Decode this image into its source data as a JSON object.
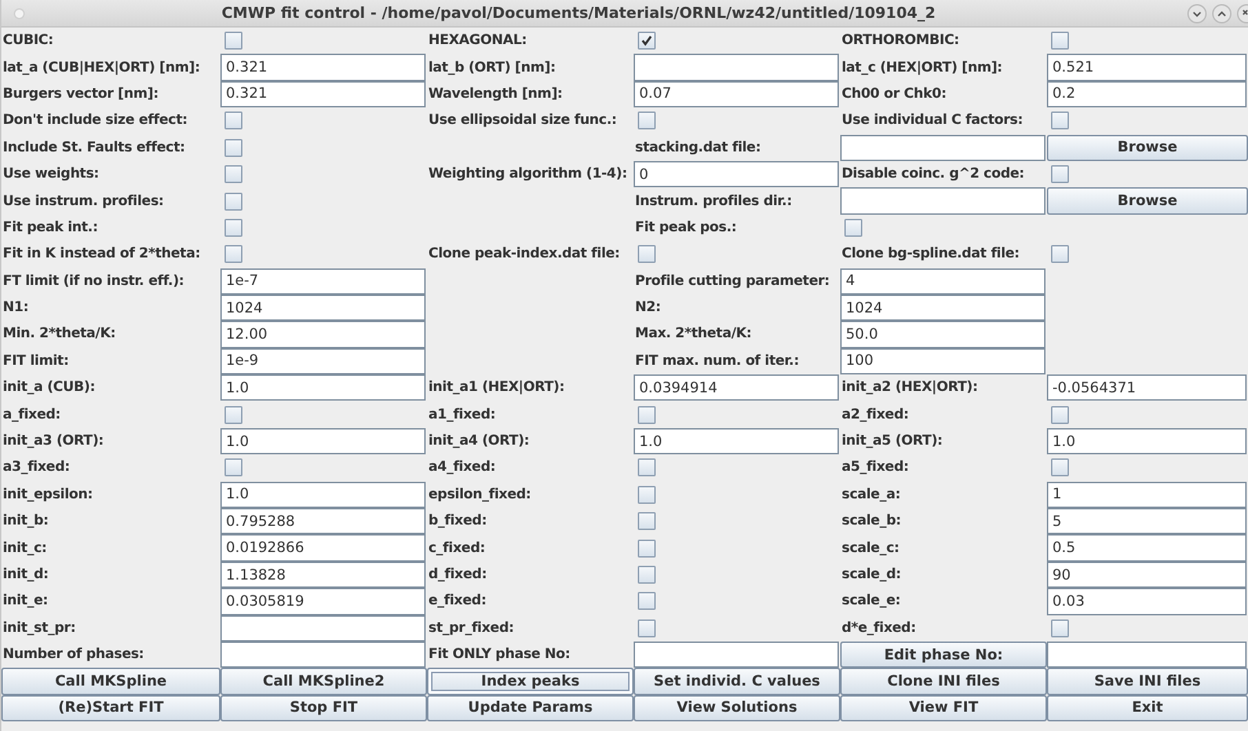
{
  "window": {
    "title": "CMWP fit control - /home/pavol/Documents/Materials/ORNL/wz42/untitled/109104_2"
  },
  "rows": [
    {
      "cells": [
        {
          "kind": "label",
          "text": "CUBIC:"
        },
        {
          "kind": "checkbox",
          "checked": false
        },
        {
          "kind": "label",
          "text": "HEXAGONAL:"
        },
        {
          "kind": "checkbox",
          "checked": true
        },
        {
          "kind": "label",
          "text": "ORTHOROMBIC:"
        },
        {
          "kind": "checkbox",
          "checked": false
        }
      ]
    },
    {
      "cells": [
        {
          "kind": "label",
          "text": "lat_a (CUB|HEX|ORT) [nm]:"
        },
        {
          "kind": "field",
          "value": "0.321"
        },
        {
          "kind": "label",
          "text": "lat_b (ORT) [nm]:"
        },
        {
          "kind": "field"
        },
        {
          "kind": "label",
          "text": "lat_c (HEX|ORT) [nm]:"
        },
        {
          "kind": "field",
          "value": "0.521"
        }
      ]
    },
    {
      "cells": [
        {
          "kind": "label",
          "text": "Burgers vector [nm]:"
        },
        {
          "kind": "field",
          "value": "0.321"
        },
        {
          "kind": "label",
          "text": "Wavelength [nm]:"
        },
        {
          "kind": "field",
          "value": "0.07"
        },
        {
          "kind": "label",
          "text": "Ch00 or Chk0:"
        },
        {
          "kind": "field",
          "value": "0.2"
        }
      ]
    },
    {
      "cells": [
        {
          "kind": "label",
          "text": "Don't include size effect:"
        },
        {
          "kind": "checkbox",
          "checked": false
        },
        {
          "kind": "label",
          "text": "Use ellipsoidal size func.:"
        },
        {
          "kind": "checkbox",
          "checked": false
        },
        {
          "kind": "label",
          "text": "Use individual C factors:"
        },
        {
          "kind": "checkbox",
          "checked": false
        }
      ]
    },
    {
      "cells": [
        {
          "kind": "label",
          "text": "Include St. Faults effect:"
        },
        {
          "kind": "checkbox",
          "checked": false
        },
        {
          "kind": "empty"
        },
        {
          "kind": "label",
          "text": "stacking.dat file:"
        },
        {
          "kind": "field"
        },
        {
          "kind": "button",
          "label": "Browse",
          "focused": false
        }
      ]
    },
    {
      "cells": [
        {
          "kind": "label",
          "text": "Use weights:"
        },
        {
          "kind": "checkbox",
          "checked": false
        },
        {
          "kind": "label",
          "text": "Weighting algorithm (1-4):"
        },
        {
          "kind": "field",
          "value": "0"
        },
        {
          "kind": "label",
          "text": "Disable coinc. g^2 code:"
        },
        {
          "kind": "checkbox",
          "checked": false
        }
      ]
    },
    {
      "cells": [
        {
          "kind": "label",
          "text": "Use instrum. profiles:"
        },
        {
          "kind": "checkbox",
          "checked": false
        },
        {
          "kind": "empty"
        },
        {
          "kind": "label",
          "text": "Instrum. profiles dir.:"
        },
        {
          "kind": "field"
        },
        {
          "kind": "button",
          "label": "Browse",
          "focused": false
        }
      ]
    },
    {
      "cells": [
        {
          "kind": "label",
          "text": "Fit peak int.:"
        },
        {
          "kind": "checkbox",
          "checked": false
        },
        {
          "kind": "empty"
        },
        {
          "kind": "label",
          "text": "Fit peak pos.:"
        },
        {
          "kind": "checkbox",
          "checked": false
        },
        {
          "kind": "empty"
        }
      ]
    },
    {
      "cells": [
        {
          "kind": "label",
          "text": "Fit in K instead of 2*theta:"
        },
        {
          "kind": "checkbox",
          "checked": false
        },
        {
          "kind": "label",
          "text": "Clone peak-index.dat file:"
        },
        {
          "kind": "checkbox",
          "checked": false
        },
        {
          "kind": "label",
          "text": "Clone bg-spline.dat file:"
        },
        {
          "kind": "checkbox",
          "checked": false
        }
      ]
    },
    {
      "cells": [
        {
          "kind": "label",
          "text": "FT limit (if no instr. eff.):"
        },
        {
          "kind": "field",
          "value": "1e-7"
        },
        {
          "kind": "empty"
        },
        {
          "kind": "label",
          "text": "Profile cutting parameter:"
        },
        {
          "kind": "field",
          "value": "4"
        },
        {
          "kind": "empty"
        }
      ]
    },
    {
      "cells": [
        {
          "kind": "label",
          "text": "N1:"
        },
        {
          "kind": "field",
          "value": "1024"
        },
        {
          "kind": "empty"
        },
        {
          "kind": "label",
          "text": "N2:"
        },
        {
          "kind": "field",
          "value": "1024"
        },
        {
          "kind": "empty"
        }
      ]
    },
    {
      "cells": [
        {
          "kind": "label",
          "text": "Min. 2*theta/K:"
        },
        {
          "kind": "field",
          "value": "12.00"
        },
        {
          "kind": "empty"
        },
        {
          "kind": "label",
          "text": "Max. 2*theta/K:"
        },
        {
          "kind": "field",
          "value": "50.0"
        },
        {
          "kind": "empty"
        }
      ]
    },
    {
      "cells": [
        {
          "kind": "label",
          "text": "FIT limit:"
        },
        {
          "kind": "field",
          "value": "1e-9"
        },
        {
          "kind": "empty"
        },
        {
          "kind": "label",
          "text": "FIT max. num. of iter.:"
        },
        {
          "kind": "field",
          "value": "100"
        },
        {
          "kind": "empty"
        }
      ]
    },
    {
      "cells": [
        {
          "kind": "label",
          "text": "init_a (CUB):"
        },
        {
          "kind": "field",
          "value": "1.0"
        },
        {
          "kind": "label",
          "text": "init_a1 (HEX|ORT):"
        },
        {
          "kind": "field",
          "value": "0.0394914"
        },
        {
          "kind": "label",
          "text": "init_a2 (HEX|ORT):"
        },
        {
          "kind": "field",
          "value": "-0.0564371"
        }
      ]
    },
    {
      "cells": [
        {
          "kind": "label",
          "text": "a_fixed:"
        },
        {
          "kind": "checkbox",
          "checked": false
        },
        {
          "kind": "label",
          "text": "a1_fixed:"
        },
        {
          "kind": "checkbox",
          "checked": false
        },
        {
          "kind": "label",
          "text": "a2_fixed:"
        },
        {
          "kind": "checkbox",
          "checked": false
        }
      ]
    },
    {
      "cells": [
        {
          "kind": "label",
          "text": "init_a3 (ORT):"
        },
        {
          "kind": "field",
          "value": "1.0"
        },
        {
          "kind": "label",
          "text": "init_a4 (ORT):"
        },
        {
          "kind": "field",
          "value": "1.0"
        },
        {
          "kind": "label",
          "text": "init_a5 (ORT):"
        },
        {
          "kind": "field",
          "value": "1.0"
        }
      ]
    },
    {
      "cells": [
        {
          "kind": "label",
          "text": "a3_fixed:"
        },
        {
          "kind": "checkbox",
          "checked": false
        },
        {
          "kind": "label",
          "text": "a4_fixed:"
        },
        {
          "kind": "checkbox",
          "checked": false
        },
        {
          "kind": "label",
          "text": "a5_fixed:"
        },
        {
          "kind": "checkbox",
          "checked": false
        }
      ]
    },
    {
      "cells": [
        {
          "kind": "label",
          "text": "init_epsilon:"
        },
        {
          "kind": "field",
          "value": "1.0"
        },
        {
          "kind": "label",
          "text": "epsilon_fixed:"
        },
        {
          "kind": "checkbox",
          "checked": false
        },
        {
          "kind": "label",
          "text": "scale_a:"
        },
        {
          "kind": "field",
          "value": "1"
        }
      ]
    },
    {
      "cells": [
        {
          "kind": "label",
          "text": "init_b:"
        },
        {
          "kind": "field",
          "value": "0.795288"
        },
        {
          "kind": "label",
          "text": "b_fixed:"
        },
        {
          "kind": "checkbox",
          "checked": false
        },
        {
          "kind": "label",
          "text": "scale_b:"
        },
        {
          "kind": "field",
          "value": "5"
        }
      ]
    },
    {
      "cells": [
        {
          "kind": "label",
          "text": "init_c:"
        },
        {
          "kind": "field",
          "value": "0.0192866"
        },
        {
          "kind": "label",
          "text": "c_fixed:"
        },
        {
          "kind": "checkbox",
          "checked": false
        },
        {
          "kind": "label",
          "text": "scale_c:"
        },
        {
          "kind": "field",
          "value": "0.5"
        }
      ]
    },
    {
      "cells": [
        {
          "kind": "label",
          "text": "init_d:"
        },
        {
          "kind": "field",
          "value": "1.13828"
        },
        {
          "kind": "label",
          "text": "d_fixed:"
        },
        {
          "kind": "checkbox",
          "checked": false
        },
        {
          "kind": "label",
          "text": "scale_d:"
        },
        {
          "kind": "field",
          "value": "90"
        }
      ]
    },
    {
      "cells": [
        {
          "kind": "label",
          "text": "init_e:"
        },
        {
          "kind": "field",
          "value": "0.0305819"
        },
        {
          "kind": "label",
          "text": "e_fixed:"
        },
        {
          "kind": "checkbox",
          "checked": false
        },
        {
          "kind": "label",
          "text": "scale_e:"
        },
        {
          "kind": "field",
          "value": "0.03"
        }
      ]
    },
    {
      "cells": [
        {
          "kind": "label",
          "text": "init_st_pr:"
        },
        {
          "kind": "field"
        },
        {
          "kind": "label",
          "text": "st_pr_fixed:"
        },
        {
          "kind": "checkbox",
          "checked": false
        },
        {
          "kind": "label",
          "text": "d*e_fixed:"
        },
        {
          "kind": "checkbox",
          "checked": false
        }
      ]
    },
    {
      "cells": [
        {
          "kind": "label",
          "text": "Number of phases:"
        },
        {
          "kind": "field"
        },
        {
          "kind": "label",
          "text": "Fit ONLY phase No:"
        },
        {
          "kind": "field"
        },
        {
          "kind": "button",
          "label": "Edit phase No:",
          "focused": false
        },
        {
          "kind": "field"
        }
      ]
    },
    {
      "cells": [
        {
          "kind": "button",
          "label": "Call MKSpline",
          "focused": false
        },
        {
          "kind": "button",
          "label": "Call MKSpline2",
          "focused": false
        },
        {
          "kind": "button",
          "label": "Index peaks",
          "focused": true
        },
        {
          "kind": "button",
          "label": "Set individ. C values",
          "focused": false
        },
        {
          "kind": "button",
          "label": "Clone INI files",
          "focused": false
        },
        {
          "kind": "button",
          "label": "Save INI files",
          "focused": false
        }
      ]
    },
    {
      "cells": [
        {
          "kind": "button",
          "label": "(Re)Start FIT",
          "focused": false
        },
        {
          "kind": "button",
          "label": "Stop FIT",
          "focused": false
        },
        {
          "kind": "button",
          "label": "Update Params",
          "focused": false
        },
        {
          "kind": "button",
          "label": "View Solutions",
          "focused": false
        },
        {
          "kind": "button",
          "label": "View FIT",
          "focused": false
        },
        {
          "kind": "button",
          "label": "Exit",
          "focused": false
        }
      ]
    }
  ]
}
